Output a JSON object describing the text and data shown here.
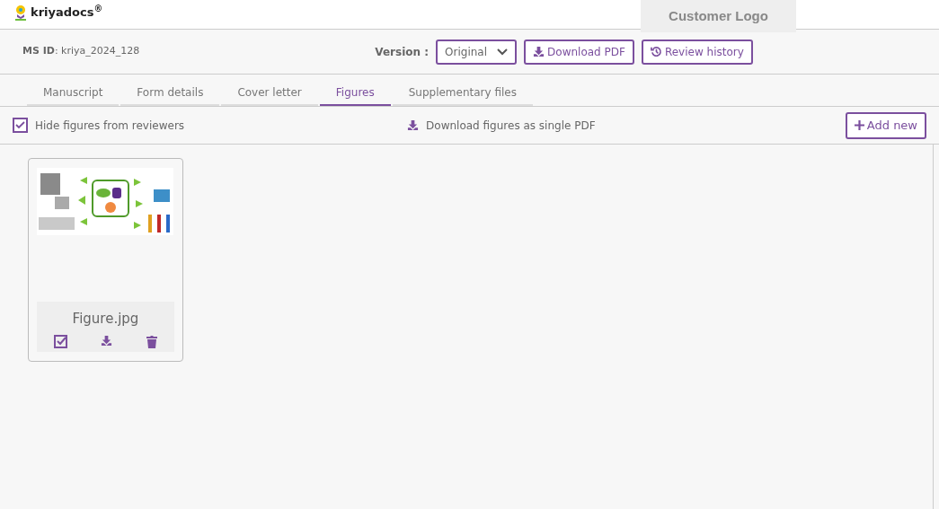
{
  "header": {
    "logo": "kriyadocs$^{®}$",
    "customer_logo": "Customer Logo"
  },
  "toolbar": {
    "ms_id": "**MS ID**: kriya_2024_128",
    "version_label": "Version :",
    "version": "Original",
    "buttons": [
      "Download PDF",
      "Review history"
    ]
  },
  "tabs": [
    {
      "label": "Manuscript",
      "selected": false
    },
    {
      "label": "Form details",
      "selected": false
    },
    {
      "label": "Cover letter",
      "selected": false
    },
    {
      "label": "Figures",
      "selected": true
    },
    {
      "label": "Supplementary files",
      "selected": false
    }
  ],
  "actions": {
    "hide_figures": {
      "label": "Hide figures from reviewers",
      "checked": true
    },
    "download_all": "Download figures as single PDF",
    "add_new": "Add new"
  },
  "figures": [
    {
      "name": "Figure.jpg",
      "kind": "picture"
    }
  ]
}
